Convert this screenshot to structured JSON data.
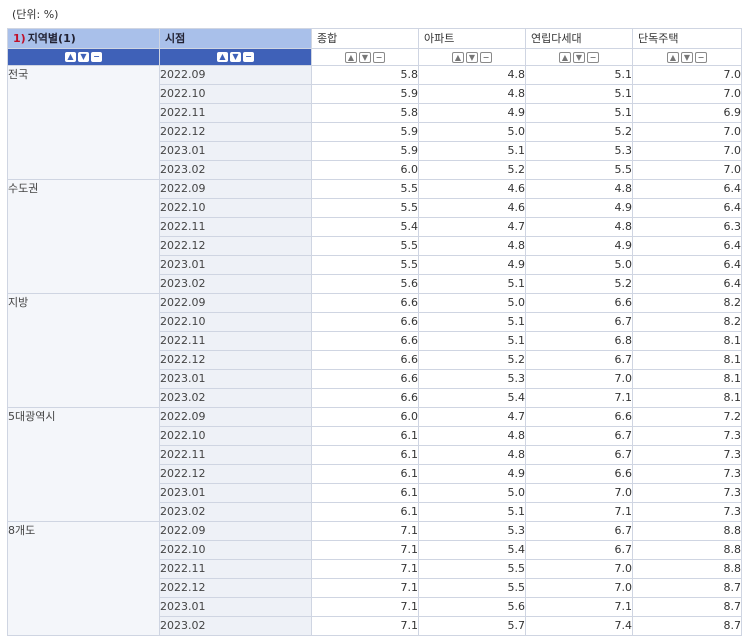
{
  "unit_label": "(단위: %)",
  "header": {
    "region": {
      "num": "1)",
      "label": "지역별(1)"
    },
    "period": "시점",
    "items": [
      "종합",
      "아파트",
      "연립다세대",
      "단독주택"
    ]
  },
  "controls": {
    "up": "▲",
    "down": "▼",
    "remove": "−"
  },
  "groups": [
    {
      "region": "전국",
      "rows": [
        {
          "period": "2022.09",
          "values": [
            "5.8",
            "4.8",
            "5.1",
            "7.0"
          ]
        },
        {
          "period": "2022.10",
          "values": [
            "5.9",
            "4.8",
            "5.1",
            "7.0"
          ]
        },
        {
          "period": "2022.11",
          "values": [
            "5.8",
            "4.9",
            "5.1",
            "6.9"
          ]
        },
        {
          "period": "2022.12",
          "values": [
            "5.9",
            "5.0",
            "5.2",
            "7.0"
          ]
        },
        {
          "period": "2023.01",
          "values": [
            "5.9",
            "5.1",
            "5.3",
            "7.0"
          ]
        },
        {
          "period": "2023.02",
          "values": [
            "6.0",
            "5.2",
            "5.5",
            "7.0"
          ]
        }
      ]
    },
    {
      "region": "수도권",
      "rows": [
        {
          "period": "2022.09",
          "values": [
            "5.5",
            "4.6",
            "4.8",
            "6.4"
          ]
        },
        {
          "period": "2022.10",
          "values": [
            "5.5",
            "4.6",
            "4.9",
            "6.4"
          ]
        },
        {
          "period": "2022.11",
          "values": [
            "5.4",
            "4.7",
            "4.8",
            "6.3"
          ]
        },
        {
          "period": "2022.12",
          "values": [
            "5.5",
            "4.8",
            "4.9",
            "6.4"
          ]
        },
        {
          "period": "2023.01",
          "values": [
            "5.5",
            "4.9",
            "5.0",
            "6.4"
          ]
        },
        {
          "period": "2023.02",
          "values": [
            "5.6",
            "5.1",
            "5.2",
            "6.4"
          ]
        }
      ]
    },
    {
      "region": "지방",
      "rows": [
        {
          "period": "2022.09",
          "values": [
            "6.6",
            "5.0",
            "6.6",
            "8.2"
          ]
        },
        {
          "period": "2022.10",
          "values": [
            "6.6",
            "5.1",
            "6.7",
            "8.2"
          ]
        },
        {
          "period": "2022.11",
          "values": [
            "6.6",
            "5.1",
            "6.8",
            "8.1"
          ]
        },
        {
          "period": "2022.12",
          "values": [
            "6.6",
            "5.2",
            "6.7",
            "8.1"
          ]
        },
        {
          "period": "2023.01",
          "values": [
            "6.6",
            "5.3",
            "7.0",
            "8.1"
          ]
        },
        {
          "period": "2023.02",
          "values": [
            "6.6",
            "5.4",
            "7.1",
            "8.1"
          ]
        }
      ]
    },
    {
      "region": "5대광역시",
      "rows": [
        {
          "period": "2022.09",
          "values": [
            "6.0",
            "4.7",
            "6.6",
            "7.2"
          ]
        },
        {
          "period": "2022.10",
          "values": [
            "6.1",
            "4.8",
            "6.7",
            "7.3"
          ]
        },
        {
          "period": "2022.11",
          "values": [
            "6.1",
            "4.8",
            "6.7",
            "7.3"
          ]
        },
        {
          "period": "2022.12",
          "values": [
            "6.1",
            "4.9",
            "6.6",
            "7.3"
          ]
        },
        {
          "period": "2023.01",
          "values": [
            "6.1",
            "5.0",
            "7.0",
            "7.3"
          ]
        },
        {
          "period": "2023.02",
          "values": [
            "6.1",
            "5.1",
            "7.1",
            "7.3"
          ]
        }
      ]
    },
    {
      "region": "8개도",
      "rows": [
        {
          "period": "2022.09",
          "values": [
            "7.1",
            "5.3",
            "6.7",
            "8.8"
          ]
        },
        {
          "period": "2022.10",
          "values": [
            "7.1",
            "5.4",
            "6.7",
            "8.8"
          ]
        },
        {
          "period": "2022.11",
          "values": [
            "7.1",
            "5.5",
            "7.0",
            "8.8"
          ]
        },
        {
          "period": "2022.12",
          "values": [
            "7.1",
            "5.5",
            "7.0",
            "8.7"
          ]
        },
        {
          "period": "2023.01",
          "values": [
            "7.1",
            "5.6",
            "7.1",
            "8.7"
          ]
        },
        {
          "period": "2023.02",
          "values": [
            "7.1",
            "5.7",
            "7.4",
            "8.7"
          ]
        }
      ]
    }
  ]
}
